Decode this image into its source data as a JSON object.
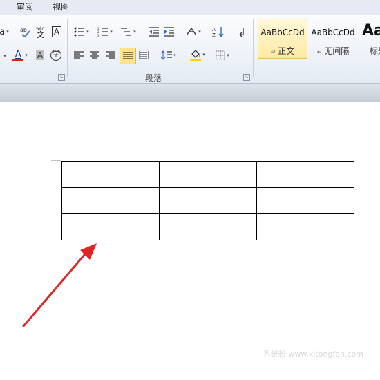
{
  "tabs": [
    "审阅",
    "视图"
  ],
  "paragraph_group": {
    "label": "段落"
  },
  "styles": [
    {
      "sample": "AaBbCcDd",
      "name": "正文",
      "selected": true
    },
    {
      "sample": "AaBbCcDd",
      "name": "无间隔",
      "selected": false
    },
    {
      "sample": "Aa",
      "name": "标题",
      "selected": false
    }
  ],
  "font_tools": {
    "font_color_letter": "A",
    "shade_letter": "A",
    "phonetic_text": "wén 文",
    "size_letter": "a",
    "border_letter": "A",
    "enclose_letter": "字"
  },
  "colors": {
    "font_color": "#e02020",
    "shading": "#ffd200",
    "arrow": "#e02424"
  },
  "table": {
    "rows": 3,
    "cols": 3
  },
  "watermark": "系统粉 www.xitongfen.com"
}
